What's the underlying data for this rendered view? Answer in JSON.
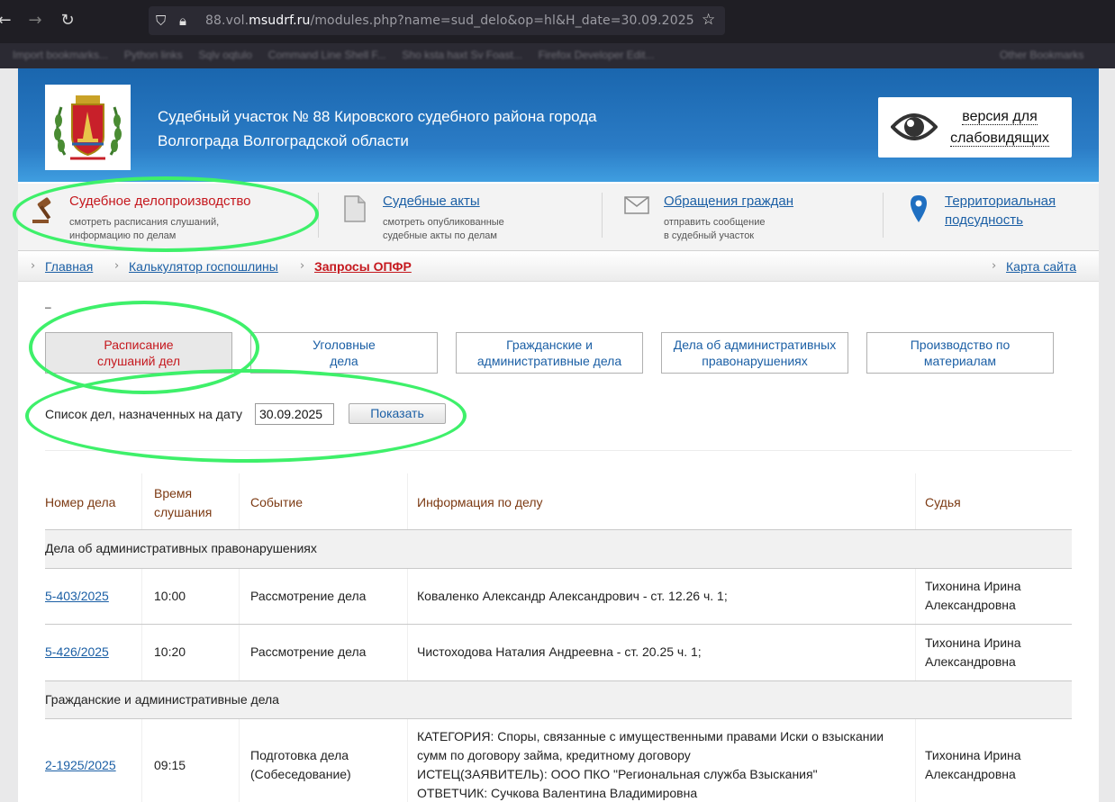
{
  "browser": {
    "url_prefix": "88.vol.",
    "url_domain": "msudrf.ru",
    "url_suffix": "/modules.php?name=sud_delo&op=hl&H_date=30.09.2025",
    "bookmarks": [
      "Import bookmarks...",
      "Python links",
      "Sqlv oqtulo",
      "Command Line Shell F...",
      "Sho ksta haxt Sv Foast...",
      "Firefox Developer Edit...",
      "Other Bookmarks"
    ]
  },
  "header": {
    "title_line1": "Судебный участок № 88 Кировского судебного района города",
    "title_line2": "Волгограда Волгоградской области",
    "vision_line1": "версия для",
    "vision_line2": "слабовидящих"
  },
  "menu": [
    {
      "title": "Судебное делопроизводство",
      "sub1": "смотреть расписания слушаний,",
      "sub2": "информацию по делам"
    },
    {
      "title": "Судебные акты",
      "sub1": "смотреть опубликованные",
      "sub2": "судебные акты по делам"
    },
    {
      "title": "Обращения граждан",
      "sub1": "отправить сообщение",
      "sub2": "в судебный участок"
    },
    {
      "title_line1": "Территориальная",
      "title_line2": "подсудность"
    }
  ],
  "breadcrumbs": {
    "home": "Главная",
    "calc": "Калькулятор госпошлины",
    "current": "Запросы ОПФР",
    "sitemap": "Карта сайта"
  },
  "dash": "–",
  "tabs": [
    {
      "line1": "Расписание",
      "line2": "слушаний дел"
    },
    {
      "line1": "Уголовные",
      "line2": "дела"
    },
    {
      "line1": "Гражданские и",
      "line2": "административные дела"
    },
    {
      "line1": "Дела об административных",
      "line2": "правонарушениях"
    },
    {
      "line1": "Производство по",
      "line2": "материалам"
    }
  ],
  "date_filter": {
    "label": "Список дел, назначенных на дату",
    "value": "30.09.2025",
    "button": "Показать"
  },
  "table": {
    "headers": {
      "number": "Номер дела",
      "time_line1": "Время",
      "time_line2": "слушания",
      "event": "Событие",
      "info": "Информация по делу",
      "judge": "Судья"
    },
    "groups": [
      {
        "title": "Дела об административных правонарушениях",
        "rows": [
          {
            "number": "5-403/2025",
            "time": "10:00",
            "event": "Рассмотрение дела",
            "info": "Коваленко Александр Александрович - ст. 12.26 ч. 1;",
            "judge_line1": "Тихонина Ирина",
            "judge_line2": "Александровна"
          },
          {
            "number": "5-426/2025",
            "time": "10:20",
            "event": "Рассмотрение дела",
            "info": "Чистоходова Наталия Андреевна - ст. 20.25 ч. 1;",
            "judge_line1": "Тихонина Ирина",
            "judge_line2": "Александровна"
          }
        ]
      },
      {
        "title": "Гражданские и административные дела",
        "rows": [
          {
            "number": "2-1925/2025",
            "time": "09:15",
            "event_line1": "Подготовка дела",
            "event_line2": "(Собеседование)",
            "info_line1": "КАТЕГОРИЯ: Споры, связанные с имущественными правами Иски о взыскании",
            "info_line2": "сумм по договору займа, кредитному договору",
            "info_line3": "ИСТЕЦ(ЗАЯВИТЕЛЬ): ООО ПКО \"Региональная служба Взыскания\"",
            "info_line4": "ОТВЕТЧИК: Сучкова Валентина Владимировна",
            "judge_line1": "Тихонина Ирина",
            "judge_line2": "Александровна"
          }
        ]
      }
    ]
  },
  "colors": {
    "header_blue": "#2b7cc6",
    "link_blue": "#1b5fa5",
    "active_red": "#c5181e",
    "annotation_green": "#3ef06a",
    "table_header_brown": "#7c3a13"
  }
}
